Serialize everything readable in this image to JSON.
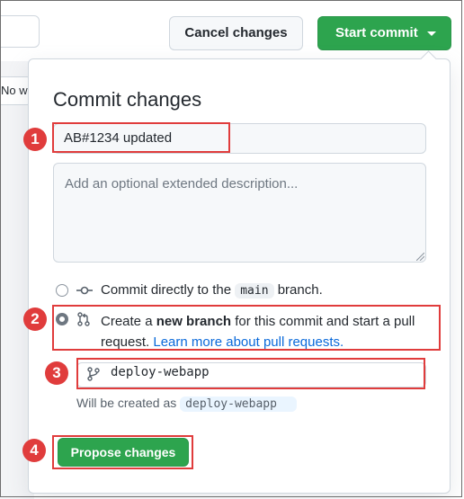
{
  "background": {
    "nowrap_fragment": "No w"
  },
  "toolbar": {
    "cancel_label": "Cancel changes",
    "start_commit_label": "Start commit"
  },
  "dialog": {
    "title": "Commit changes",
    "summary_value": "AB#1234 updated",
    "description_placeholder": "Add an optional extended description...",
    "option_direct": {
      "prefix": "Commit directly to the",
      "branch": "main",
      "suffix": "branch.",
      "selected": false
    },
    "option_new_branch": {
      "prefix": "Create a",
      "bold": "new branch",
      "suffix": "for this commit and start a pull request.",
      "link": "Learn more about pull requests.",
      "selected": true
    },
    "branch_name_value": "deploy-webapp",
    "created_note_prefix": "Will be created as",
    "created_note_branch": "deploy-webapp",
    "propose_label": "Propose changes"
  },
  "callouts": {
    "one": "1",
    "two": "2",
    "three": "3",
    "four": "4",
    "color": "#e03c3c"
  },
  "colors": {
    "primary_green": "#2da44e",
    "link_blue": "#0969da"
  }
}
